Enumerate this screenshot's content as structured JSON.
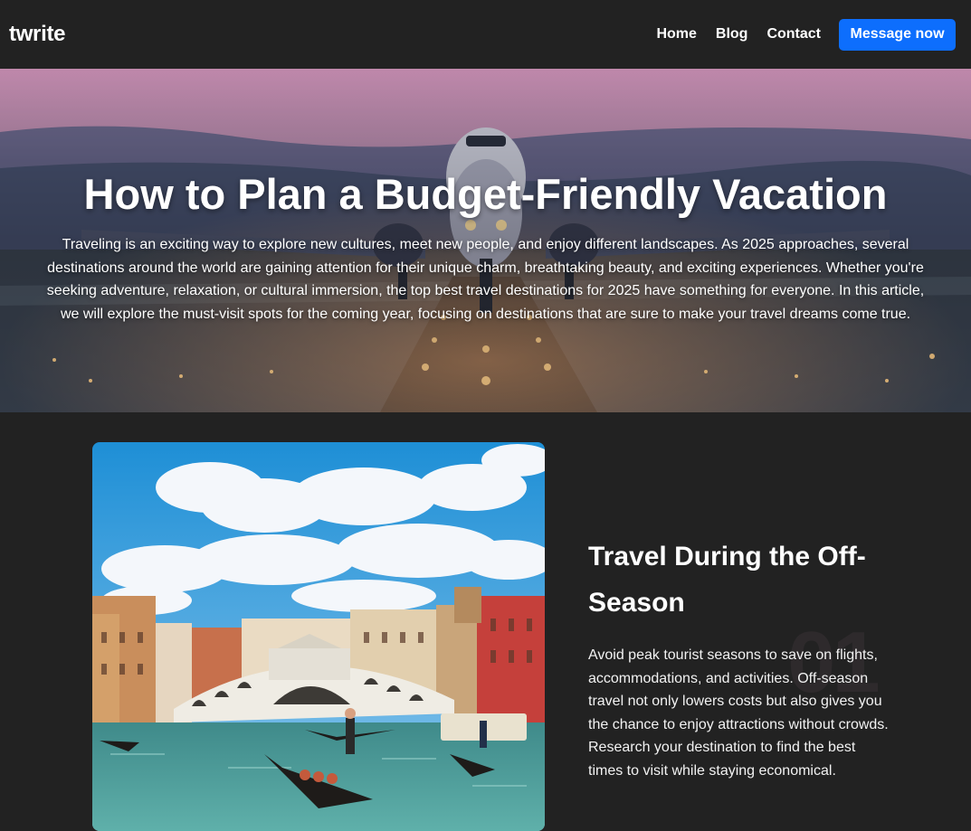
{
  "brand": "twrite",
  "nav": {
    "links": [
      "Home",
      "Blog",
      "Contact"
    ],
    "cta_label": "Message now"
  },
  "hero": {
    "title": "How to Plan a Budget-Friendly Vacation",
    "text": "Traveling is an exciting way to explore new cultures, meet new people, and enjoy different landscapes. As 2025 approaches, several destinations around the world are gaining attention for their unique charm, breathtaking beauty, and exciting experiences. Whether you're seeking adventure, relaxation, or cultural immersion, the top best travel destinations for 2025 have something for everyone. In this article, we will explore the must-visit spots for the coming year, focusing on destinations that are sure to make your travel dreams come true.",
    "image": "airplane-takeoff-runway-photo"
  },
  "feature": {
    "number": "01",
    "title": "Travel During the Off-Season",
    "body": "Avoid peak tourist seasons to save on flights, accommodations, and activities. Off-season travel not only lowers costs but also gives you the chance to enjoy attractions without crowds. Research your destination to find the best times to visit while staying economical.",
    "image": "venice-rialto-bridge-gondola-photo"
  },
  "colors": {
    "background": "#222222",
    "accent": "#0d6efd",
    "text": "#ffffff"
  }
}
